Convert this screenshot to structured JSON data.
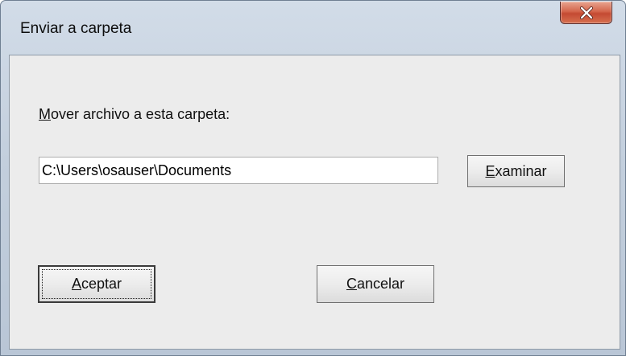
{
  "window": {
    "title": "Enviar a carpeta",
    "close_icon": "close-icon"
  },
  "dialog": {
    "prompt_accel": "M",
    "prompt_rest": "over archivo a esta carpeta:",
    "path_value": "C:\\Users\\osauser\\Documents",
    "browse_accel": "E",
    "browse_rest": "xaminar",
    "ok_accel": "A",
    "ok_rest": "ceptar",
    "cancel_accel": "C",
    "cancel_rest": "ancelar"
  },
  "colors": {
    "frame": "#c3cfdd",
    "close_button": "#c44a33",
    "client_background": "#ececec"
  }
}
